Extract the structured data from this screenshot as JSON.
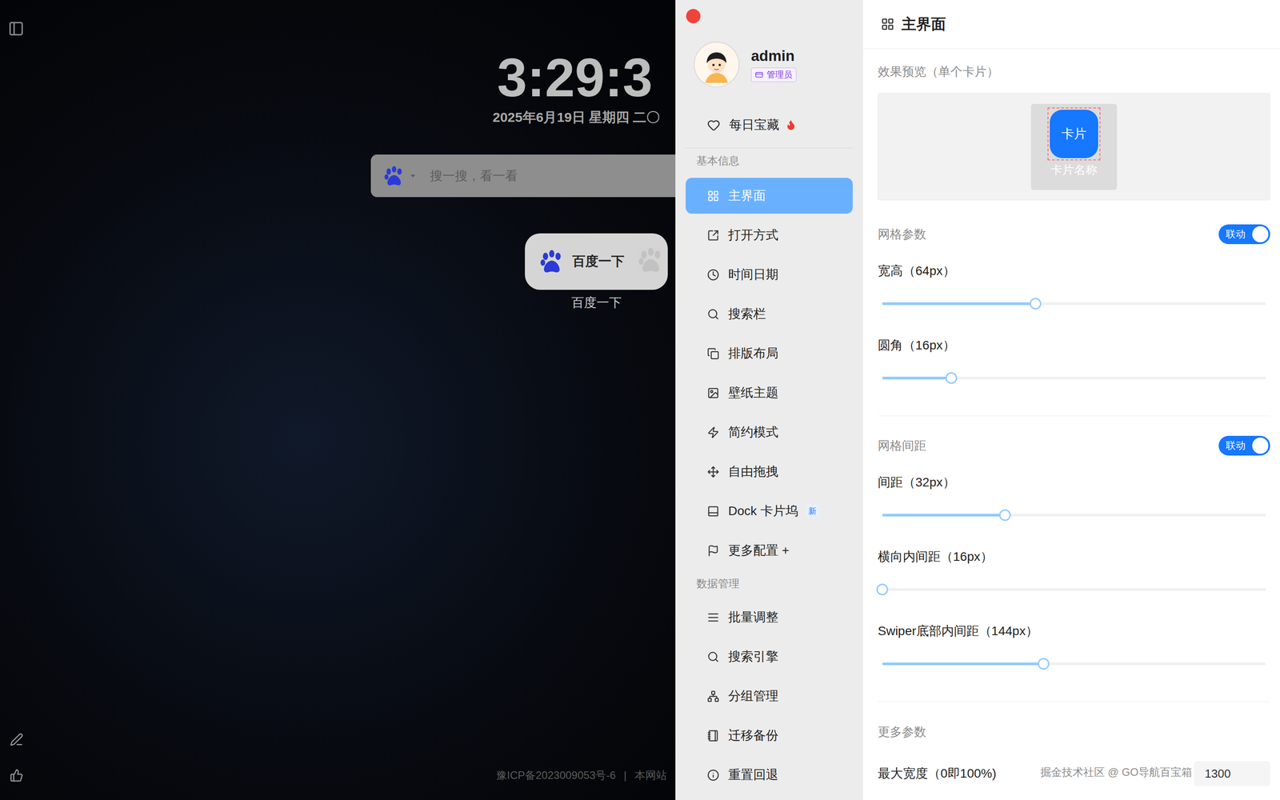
{
  "wallpaper": {
    "clock": "3:29:3",
    "date": "2025年6月19日 星期四 二〇",
    "search": {
      "placeholder": "搜一搜，看一看"
    },
    "cards": [
      {
        "title": "百度一下",
        "label": "百度一下"
      }
    ],
    "footer": {
      "icp": "豫ICP备2023009053号-6",
      "separator": "|",
      "note": "本网站"
    }
  },
  "sidebar": {
    "user": {
      "name": "admin",
      "role": "管理员"
    },
    "featured": {
      "label": "每日宝藏",
      "hot": true
    },
    "groups": [
      {
        "title": "基本信息",
        "items": [
          {
            "label": "主界面",
            "selected": true
          },
          {
            "label": "打开方式",
            "selected": false
          },
          {
            "label": "时间日期",
            "selected": false
          },
          {
            "label": "搜索栏",
            "selected": false
          },
          {
            "label": "排版布局",
            "selected": false
          },
          {
            "label": "壁纸主题",
            "selected": false
          },
          {
            "label": "简约模式",
            "selected": false
          },
          {
            "label": "自由拖拽",
            "selected": false
          },
          {
            "label": "Dock 卡片坞",
            "selected": false,
            "badge": "新"
          },
          {
            "label": "更多配置 +",
            "selected": false
          }
        ]
      },
      {
        "title": "数据管理",
        "items": [
          {
            "label": "批量调整",
            "selected": false
          },
          {
            "label": "搜索引擎",
            "selected": false
          },
          {
            "label": "分组管理",
            "selected": false
          },
          {
            "label": "迁移备份",
            "selected": false
          },
          {
            "label": "重置回退",
            "selected": false
          }
        ]
      }
    ]
  },
  "panel": {
    "title": "主界面",
    "preview": {
      "title": "效果预览（单个卡片）",
      "card_text": "卡片",
      "card_name": "卡片名称"
    },
    "sections": [
      {
        "title": "网格参数",
        "toggle": {
          "label": "联动",
          "on": true
        },
        "sliders": [
          {
            "label": "宽高（64px）",
            "level": 0.4
          },
          {
            "label": "圆角（16px）",
            "level": 0.18
          }
        ]
      },
      {
        "title": "网格间距",
        "toggle": {
          "label": "联动",
          "on": true
        },
        "sliders": [
          {
            "label": "间距（32px）",
            "level": 0.32
          },
          {
            "label": "横向内间距（16px）",
            "level": 0
          },
          {
            "label": "Swiper底部内间距（144px）",
            "level": 0.42
          }
        ]
      }
    ],
    "more": {
      "title": "更多参数",
      "fields": [
        {
          "label": "最大宽度（0即100%)",
          "value": "1300"
        }
      ]
    }
  },
  "watermark": "掘金技术社区 @ GO导航百宝箱"
}
